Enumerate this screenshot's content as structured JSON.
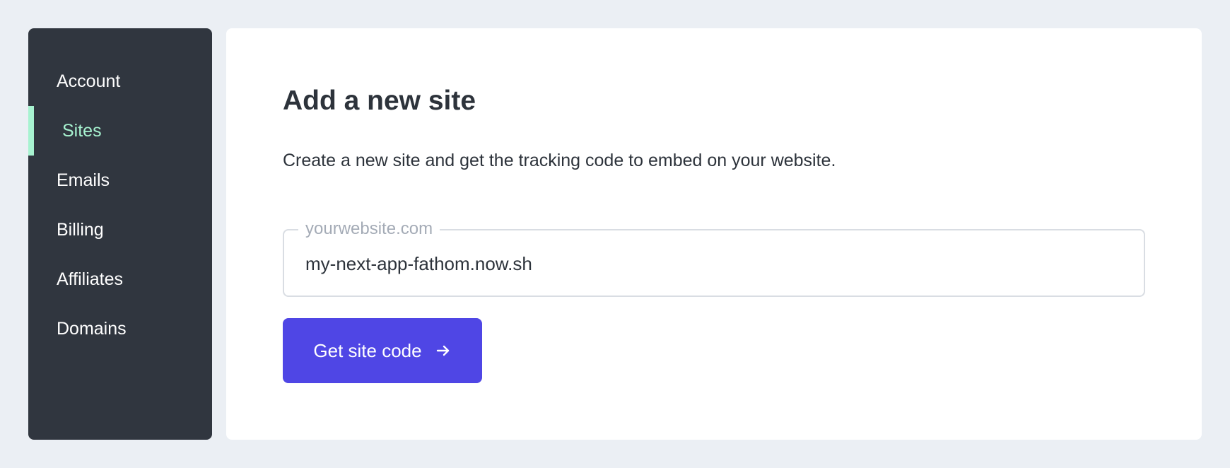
{
  "sidebar": {
    "items": [
      {
        "label": "Account"
      },
      {
        "label": "Sites",
        "active": true
      },
      {
        "label": "Emails"
      },
      {
        "label": "Billing"
      },
      {
        "label": "Affiliates"
      },
      {
        "label": "Domains"
      }
    ],
    "accent_color": "#a7f3d0"
  },
  "main": {
    "title": "Add a new site",
    "description": "Create a new site and get the tracking code to embed on your website.",
    "site_field": {
      "label": "yourwebsite.com",
      "value": "my-next-app-fathom.now.sh"
    },
    "submit_button": {
      "label": "Get site code",
      "icon": "arrow-right-icon",
      "color": "#4f46e5"
    }
  }
}
